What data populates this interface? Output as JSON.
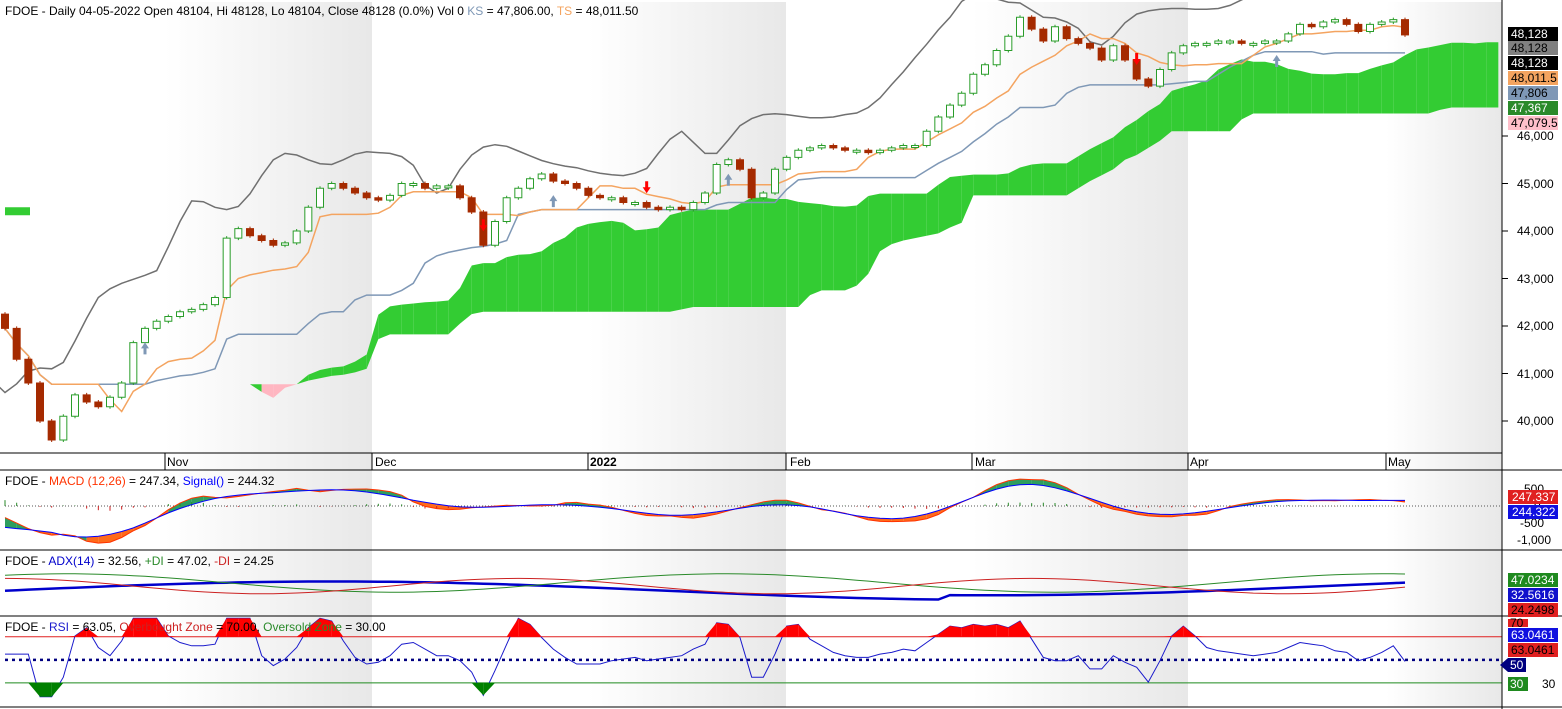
{
  "colors": {
    "up": "#2a9d2a",
    "down": "#a52a00",
    "kijun": "#7f98b6",
    "tenkan": "#f4a460",
    "chikou": "#707070",
    "cloud_bull": "#33cc33",
    "cloud_bear": "#ffb6c1",
    "macd_line": "#ff3300",
    "signal_line": "#0000ff",
    "adx": "#0000cc",
    "plus_di": "#2a8a2a",
    "minus_di": "#cc2222",
    "rsi": "#1a1acc",
    "ob_fill": "#ff0000",
    "os_fill": "#008000"
  },
  "main": {
    "header_prefix": "FDOE - Daily 04-05-2022 Open 48104, Hi 48128, Lo 48104, Close 48128 (0.0%) Vol 0",
    "ks_label": "KS",
    "ks_value": " = 47,806.00,",
    "ts_label": "TS",
    "ts_value": " = 48,011.50",
    "price_ticks": [
      "40,000",
      "41,000",
      "42,000",
      "43,000",
      "44,000",
      "45,000",
      "46,000"
    ],
    "badges": [
      {
        "text": "48,128",
        "bg": "#000000",
        "fg": "#ffffff"
      },
      {
        "text": "48,128",
        "bg": "#808080",
        "fg": "#000000"
      },
      {
        "text": "48,128",
        "bg": "#000000",
        "fg": "#ffffff"
      },
      {
        "text": "48,011.5",
        "bg": "#f4a460",
        "fg": "#000000"
      },
      {
        "text": "47,806",
        "bg": "#7f98b6",
        "fg": "#000000"
      },
      {
        "text": "47,367",
        "bg": "#2a8a2a",
        "fg": "#ffffff"
      },
      {
        "text": "47,079.5",
        "bg": "#ffc0cb",
        "fg": "#000000"
      }
    ]
  },
  "months": [
    "Nov",
    "Dec",
    "2022",
    "Feb",
    "Mar",
    "Apr",
    "May"
  ],
  "macd": {
    "prefix": "FDOE - ",
    "name": "MACD (12,26)",
    "value": " = 247.34, ",
    "signal_name": "Signal()",
    "signal_value": " = 244.32",
    "ticks": [
      "500",
      "0",
      "-500",
      "-1,000"
    ],
    "badge_macd": "247.337",
    "badge_signal": "244.322"
  },
  "adx": {
    "prefix": "FDOE - ",
    "name": "ADX(14)",
    "value": " = 32.56, ",
    "plus_name": "+DI",
    "plus_value": " = 47.02, ",
    "minus_name": "-DI",
    "minus_value": " = 24.25",
    "badge_plus": "47.0234",
    "badge_adx": "32.5616",
    "badge_minus": "24.2498"
  },
  "rsi": {
    "prefix": "FDOE - ",
    "name": "RSI",
    "value": " = 63.05, ",
    "ob_name": "Overbought Zone",
    "ob_value": " = 70.00, ",
    "os_name": "Oversold Zone",
    "os_value": " = 30.00",
    "badge_70": "70",
    "badge_rsi1": "63.0461",
    "badge_rsi2": "63.0461",
    "badge_50": "50",
    "badge_30": "30",
    "tick_30": "30"
  },
  "chart_data": {
    "type": "line",
    "title": "FDOE - Daily 04-05-2022",
    "ohlc_last": {
      "open": 48104,
      "high": 48128,
      "low": 48104,
      "close": 48128,
      "volume": 0
    },
    "ichimoku": {
      "kijun_sen": 47806.0,
      "tenkan_sen": 48011.5,
      "senkou_a": 47367,
      "senkou_b": 47079.5
    },
    "ylim": [
      39500,
      48500
    ],
    "x_months": [
      "Nov",
      "Dec",
      "2022",
      "Feb",
      "Mar",
      "Apr",
      "May"
    ],
    "closes": [
      41950,
      41300,
      40800,
      40000,
      39600,
      40100,
      40550,
      40400,
      40300,
      40500,
      40800,
      41650,
      41950,
      42100,
      42200,
      42300,
      42350,
      42450,
      42600,
      43850,
      44050,
      43900,
      43800,
      43700,
      43750,
      44000,
      44500,
      44900,
      45000,
      44900,
      44800,
      44700,
      44650,
      44750,
      45000,
      45000,
      44900,
      44950,
      44950,
      44700,
      44400,
      43700,
      44200,
      44700,
      44900,
      45100,
      45200,
      45050,
      45000,
      44900,
      44750,
      44700,
      44700,
      44600,
      44600,
      44500,
      44450,
      44500,
      44450,
      44600,
      44800,
      45400,
      45500,
      45300,
      44700,
      44800,
      45300,
      45550,
      45700,
      45750,
      45800,
      45750,
      45700,
      45700,
      45650,
      45700,
      45750,
      45800,
      45800,
      46100,
      46400,
      46650,
      46900,
      47300,
      47500,
      47800,
      48100,
      48500,
      48250,
      48000,
      48300,
      48050,
      47950,
      47850,
      47600,
      47900,
      47600,
      47200,
      47050,
      47400,
      47750,
      47900,
      47950,
      47950,
      48000,
      48000,
      47950,
      47950,
      48000,
      48000,
      48150,
      48350,
      48300,
      48400,
      48450,
      48350,
      48200,
      48350,
      48400,
      48450,
      48128
    ],
    "macd": {
      "last": 247.34,
      "signal": 244.32,
      "ylim": [
        -1200,
        650
      ]
    },
    "adx": {
      "adx": 32.56,
      "plus_di": 47.02,
      "minus_di": 24.25
    },
    "rsi": {
      "last": 63.05,
      "overbought": 70,
      "oversold": 30
    }
  }
}
